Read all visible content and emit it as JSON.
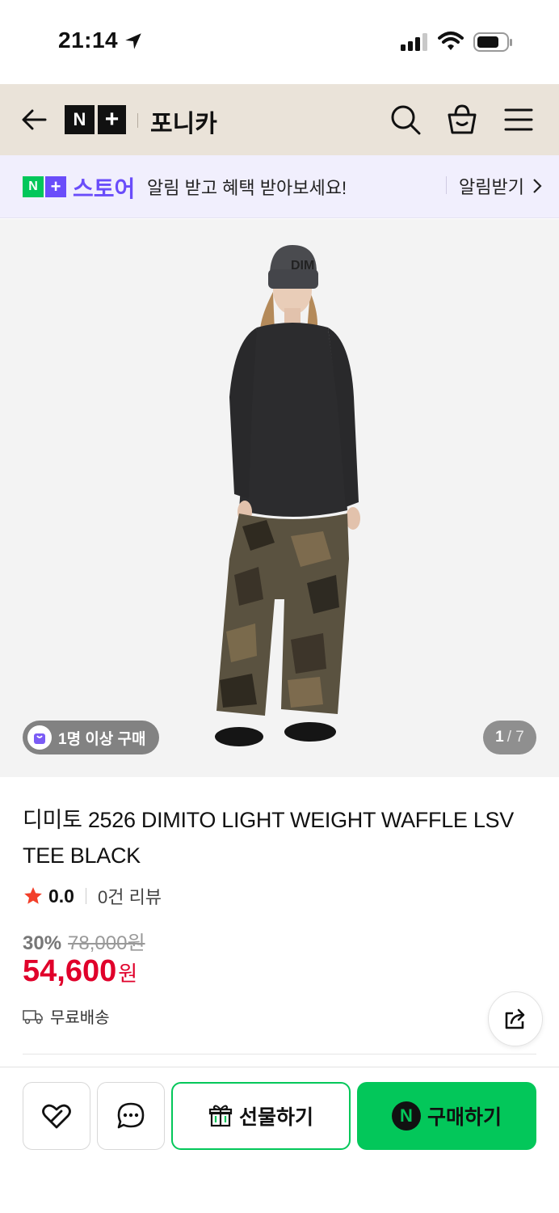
{
  "status_bar": {
    "time": "21:14"
  },
  "header": {
    "logo_n": "N",
    "logo_plus": "+",
    "store_name": "포니카"
  },
  "promo": {
    "logo_n": "N",
    "logo_plus": "+",
    "store_label": "스토어",
    "message": "알림 받고 혜택 받아보세요!",
    "action_label": "알림받기"
  },
  "gallery": {
    "buyers_badge": "1명 이상 구매",
    "current_page": "1",
    "total_pages": "/ 7"
  },
  "product": {
    "name": "디미토 2526 DIMITO LIGHT WEIGHT WAFFLE LSV TEE BLACK",
    "rating": "0.0",
    "review_count": "0건 리뷰",
    "discount_rate": "30%",
    "original_price": "78,000원",
    "sale_price": "54,600",
    "sale_unit": "원",
    "shipping": "무료배송"
  },
  "bottom_bar": {
    "gift_label": "선물하기",
    "buy_label": "구매하기",
    "npay_letter": "N"
  },
  "colors": {
    "naver_green": "#03c75a",
    "store_purple": "#6a4dfa",
    "price_red": "#e0002a",
    "header_bg": "#eae3d9"
  }
}
